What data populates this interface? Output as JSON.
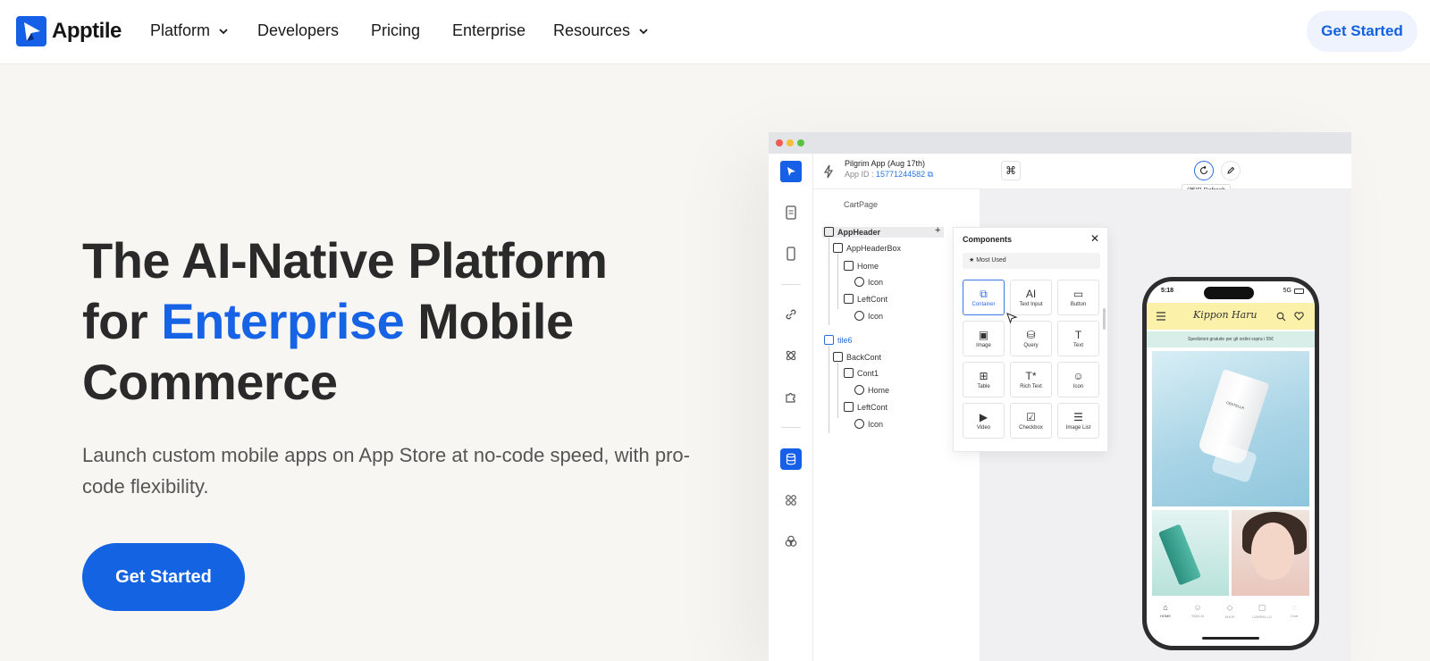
{
  "nav": {
    "logo_text": "Apptile",
    "items": [
      {
        "label": "Platform",
        "has_dropdown": true
      },
      {
        "label": "Developers",
        "has_dropdown": false
      },
      {
        "label": "Pricing",
        "has_dropdown": false
      },
      {
        "label": "Enterprise",
        "has_dropdown": false
      },
      {
        "label": "Resources",
        "has_dropdown": true
      }
    ],
    "cta": "Get Started"
  },
  "hero": {
    "title_part1": "The AI-Native Platform",
    "title_for": "for",
    "title_accent": "Enterprise",
    "title_mobile": "Mobile",
    "title_part3": "Commerce",
    "subtitle": "Launch custom mobile apps on App Store at no-code speed, with pro-code flexibility.",
    "cta": "Get Started"
  },
  "colors": {
    "accent": "#1763e6",
    "cta_bg": "#1463e2",
    "nav_cta_bg": "#eef3fd",
    "page_bg": "#f8f6f3"
  },
  "editor": {
    "app_name": "Pilgrim App (Aug 17th)",
    "app_id_label": "App ID :",
    "app_id": "15771244582",
    "page_name": "CartPage",
    "cmd_key": "⌘",
    "tooltip": "(⌘)R  Refresh",
    "tree": [
      {
        "label": "AppHeader",
        "type": "box",
        "bold": true
      },
      {
        "label": "AppHeaderBox",
        "type": "box"
      },
      {
        "label": "Home",
        "type": "box"
      },
      {
        "label": "Icon",
        "type": "face"
      },
      {
        "label": "LeftCont",
        "type": "box"
      },
      {
        "label": "Icon",
        "type": "face"
      },
      {
        "label": "tile6",
        "type": "box",
        "accent": true
      },
      {
        "label": "BackCont",
        "type": "box"
      },
      {
        "label": "Cont1",
        "type": "box"
      },
      {
        "label": "Home",
        "type": "face"
      },
      {
        "label": "LeftCont",
        "type": "box"
      },
      {
        "label": "Icon",
        "type": "face"
      }
    ],
    "components": {
      "title": "Components",
      "close": "✕",
      "filter": "★ Most Used",
      "tiles": [
        {
          "label": "Container",
          "icon": "container-icon",
          "glyph": "⧉",
          "selected": true
        },
        {
          "label": "Text Input",
          "icon": "text-input-icon",
          "glyph": "AI"
        },
        {
          "label": "Button",
          "icon": "button-icon",
          "glyph": "▭"
        },
        {
          "label": "Image",
          "icon": "image-icon",
          "glyph": "▣"
        },
        {
          "label": "Query",
          "icon": "query-icon",
          "glyph": "⛁"
        },
        {
          "label": "Text",
          "icon": "text-icon",
          "glyph": "T"
        },
        {
          "label": "Table",
          "icon": "table-icon",
          "glyph": "⊞"
        },
        {
          "label": "Rich Text",
          "icon": "rich-text-icon",
          "glyph": "T*"
        },
        {
          "label": "Icon",
          "icon": "smiley-icon",
          "glyph": "☺"
        },
        {
          "label": "Video",
          "icon": "video-icon",
          "glyph": "▶"
        },
        {
          "label": "Checkbox",
          "icon": "checkbox-icon",
          "glyph": "☑"
        },
        {
          "label": "Image List",
          "icon": "list-icon",
          "glyph": "☰"
        }
      ]
    }
  },
  "phone": {
    "time": "5:18",
    "signal": "5G",
    "brand": "Kippon Haru",
    "promo": "Spedizioni gratuite per gli ordini sopra i 55€",
    "product_label": "CENTELLA",
    "tabs": [
      "HOME",
      "SKIN AI",
      "SHOP",
      "CARRELLO",
      "Chat"
    ]
  }
}
